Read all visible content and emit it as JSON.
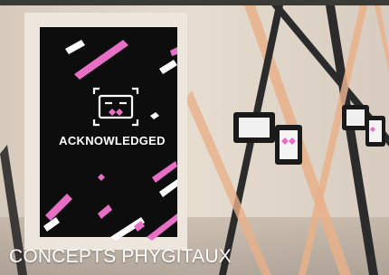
{
  "poster": {
    "brand": "ACKNOWLEDGED",
    "logo": "robot-face-logo-icon"
  },
  "caption": "CONCEPTS PHYGITAUX",
  "colors": {
    "wall": "#dcd1c4",
    "poster_bg": "#0d0d0d",
    "accent_pink": "#e86fc6",
    "stripe_dark": "#2a2a2a",
    "stripe_peach": "#e8b08a"
  }
}
